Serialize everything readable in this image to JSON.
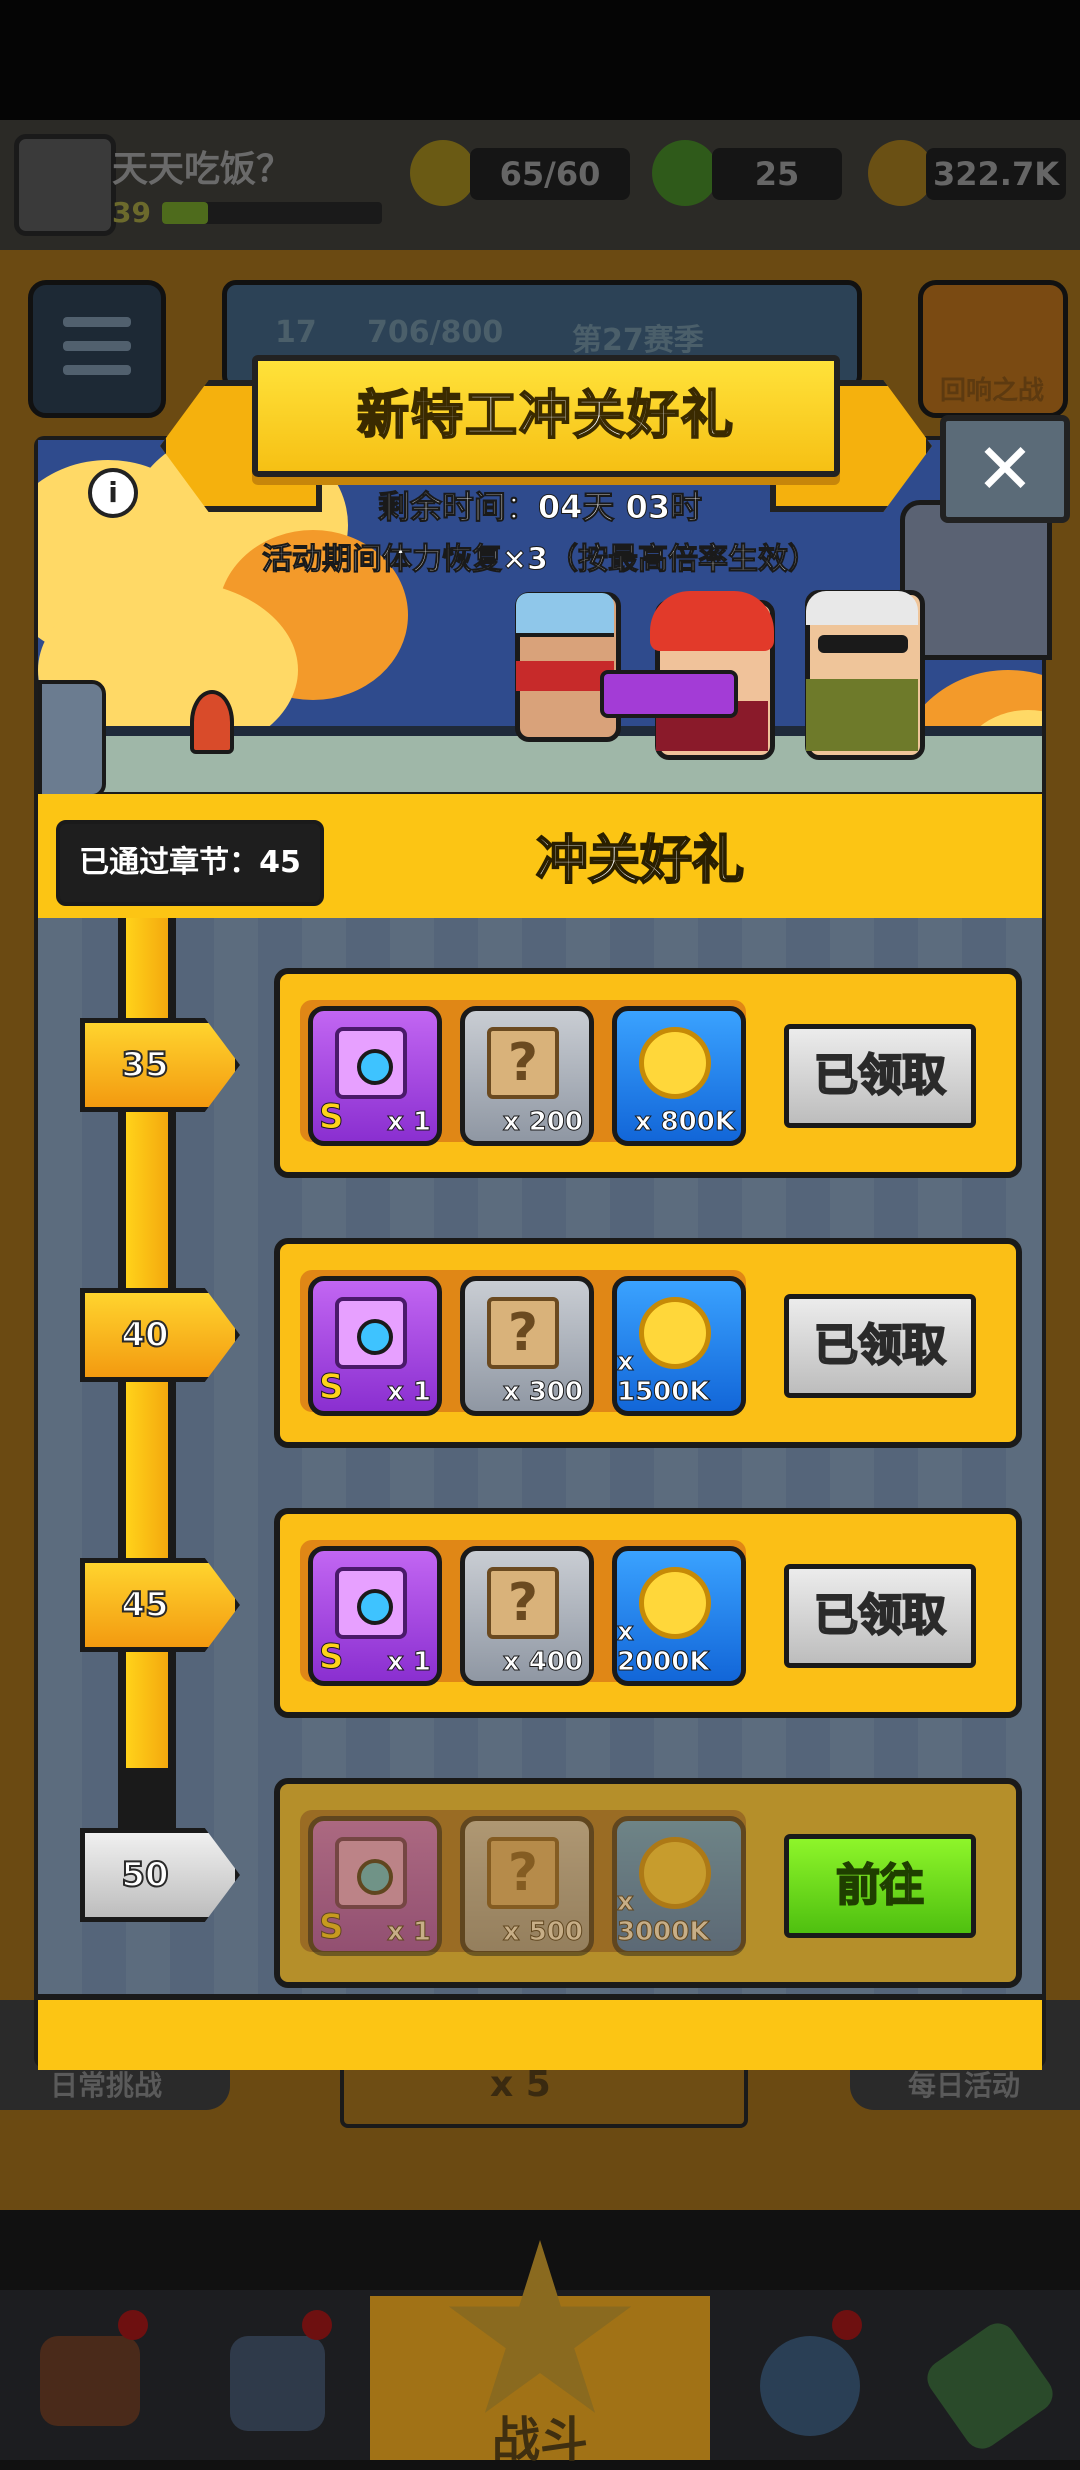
{
  "player": {
    "name": "天天吃饭？",
    "level": "39"
  },
  "resources": {
    "energy": "65/60",
    "gems": "25",
    "coins": "322.7K"
  },
  "background": {
    "season_progress": "706/800",
    "season_label": "第27赛季",
    "season_level": "17",
    "echo_battle_label": "回响之战",
    "daily_challenge_label": "日常挑战",
    "daily_event_label": "每日活动",
    "stamina_cost": "x 5",
    "battle_label": "战斗"
  },
  "modal": {
    "title": "新特工冲关好礼",
    "close_symbol": "✕",
    "info_symbol": "i",
    "time_remaining": "剩余时间：04天 03时",
    "event_note": "活动期间体力恢复×3（按最高倍率生效）",
    "chapters_passed": "已通过章节：45",
    "section_title": "冲关好礼"
  },
  "tiers": [
    {
      "level": "35",
      "items": [
        {
          "qty": "x 1",
          "grade": "S"
        },
        {
          "qty": "x 200"
        },
        {
          "qty": "x 800K"
        }
      ],
      "button": "已领取",
      "state": "claimed"
    },
    {
      "level": "40",
      "items": [
        {
          "qty": "x 1",
          "grade": "S"
        },
        {
          "qty": "x 300"
        },
        {
          "qty": "x 1500K"
        }
      ],
      "button": "已领取",
      "state": "claimed"
    },
    {
      "level": "45",
      "items": [
        {
          "qty": "x 1",
          "grade": "S"
        },
        {
          "qty": "x 400"
        },
        {
          "qty": "x 2000K"
        }
      ],
      "button": "已领取",
      "state": "claimed"
    },
    {
      "level": "50",
      "items": [
        {
          "qty": "x 1",
          "grade": "S"
        },
        {
          "qty": "x 500"
        },
        {
          "qty": "x 3000K"
        }
      ],
      "button": "前往",
      "state": "go"
    }
  ],
  "colors": {
    "accent_yellow": "#fcc514",
    "go_green": "#6fd81d",
    "claimed_gray": "#c9c9c9",
    "panel_blue": "#5c6c7e"
  }
}
